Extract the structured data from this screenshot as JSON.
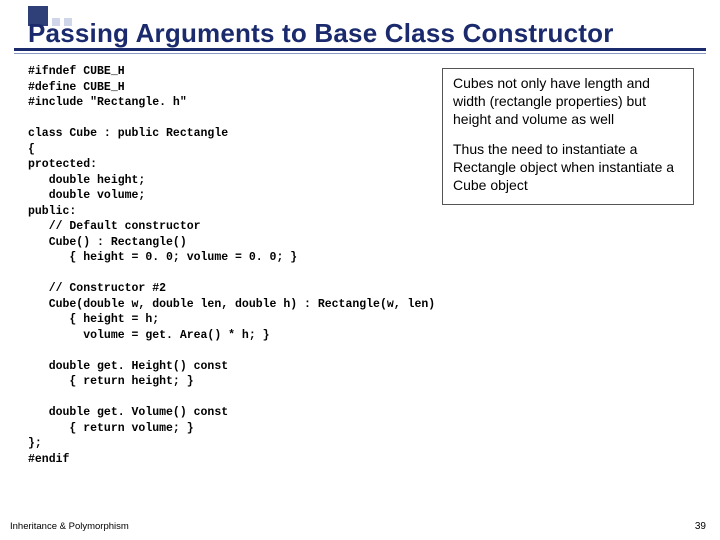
{
  "title": "Passing Arguments to Base Class Constructor",
  "code": "#ifndef CUBE_H\n#define CUBE_H\n#include \"Rectangle. h\"\n\nclass Cube : public Rectangle\n{\nprotected:\n   double height;\n   double volume;\npublic:\n   // Default constructor\n   Cube() : Rectangle()\n      { height = 0. 0; volume = 0. 0; }\n\n   // Constructor #2\n   Cube(double w, double len, double h) : Rectangle(w, len)\n      { height = h;\n        volume = get. Area() * h; }\n\n   double get. Height() const\n      { return height; }\n\n   double get. Volume() const\n      { return volume; }\n};\n#endif",
  "callout": {
    "p1": "Cubes not only have length and width (rectangle properties)  but height and volume as well",
    "p2": "Thus the need to instantiate a Rectangle object when instantiate a Cube object"
  },
  "footer": {
    "left": "Inheritance & Polymorphism",
    "page": "39"
  }
}
